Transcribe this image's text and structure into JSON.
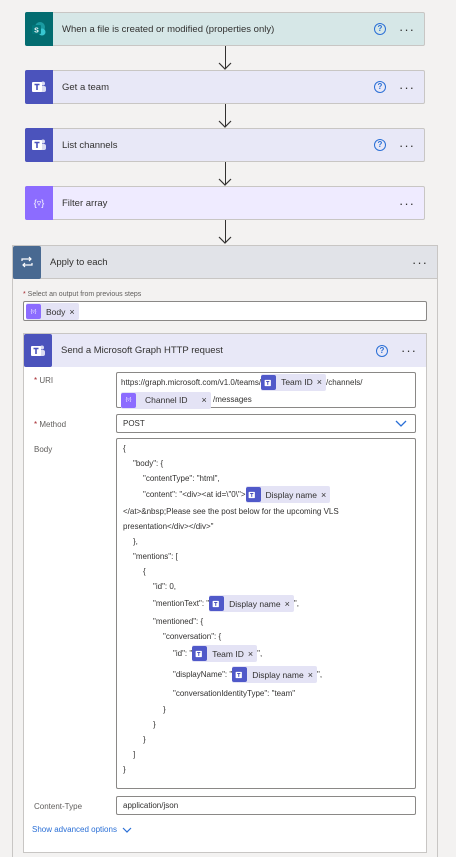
{
  "steps": [
    {
      "title": "When a file is created or modified (properties only)",
      "icon": "sharepoint-icon",
      "color": "#036c70",
      "bg": "#d6e7e7",
      "help": true
    },
    {
      "title": "Get a team",
      "icon": "teams-icon",
      "color": "#4b53bc",
      "bg": "#e8e8f7",
      "help": true
    },
    {
      "title": "List channels",
      "icon": "teams-icon",
      "color": "#4b53bc",
      "bg": "#e8e8f7",
      "help": true
    },
    {
      "title": "Filter array",
      "icon": "filter-array-icon",
      "color": "#8c6cff",
      "bg": "#efebff",
      "help": false
    }
  ],
  "apply_to_each": {
    "title": "Apply to each",
    "select_label": "Select an output from previous steps",
    "select_token": "Body"
  },
  "http_action": {
    "title": "Send a Microsoft Graph HTTP request",
    "uri_label": "URI",
    "uri": {
      "prefix": "https://graph.microsoft.com/v1.0/teams/",
      "team_token": "Team ID",
      "middle": "/channels/",
      "channel_token": "Channel ID",
      "suffix": "/messages"
    },
    "method_label": "Method",
    "method_value": "POST",
    "body_label": "Body",
    "body": {
      "l1": "{",
      "l2": "\"body\": {",
      "l3": "\"contentType\": \"html\",",
      "l4a": "\"content\": \"<div><at id=\\\"0\\\">",
      "l4_token": "Display name",
      "l5": "</at>&nbsp;Please see the post below for the upcoming VLS",
      "l6": "presentation</div></div>\"",
      "l7": "},",
      "l8": "\"mentions\": [",
      "l9": "{",
      "l10": "\"id\": 0,",
      "l11a": "\"mentionText\": \"",
      "l11_token": "Display name",
      "l11b": "\",",
      "l12": "\"mentioned\": {",
      "l13": "\"conversation\": {",
      "l14a": "\"id\": \"",
      "l14_token": "Team ID",
      "l14b": "\",",
      "l15a": "\"displayName\": \"",
      "l15_token": "Display name",
      "l15b": "\",",
      "l16": "\"conversationIdentityType\": \"team\"",
      "l17": "}",
      "l18": "}",
      "l19": "}",
      "l20": "]",
      "l21": "}"
    },
    "content_type_label": "Content-Type",
    "content_type_value": "application/json",
    "advanced_label": "Show advanced options"
  },
  "glyphs": {
    "help": "?",
    "dots": "···",
    "close": "×",
    "sp": "S",
    "filter": "{▿}"
  }
}
